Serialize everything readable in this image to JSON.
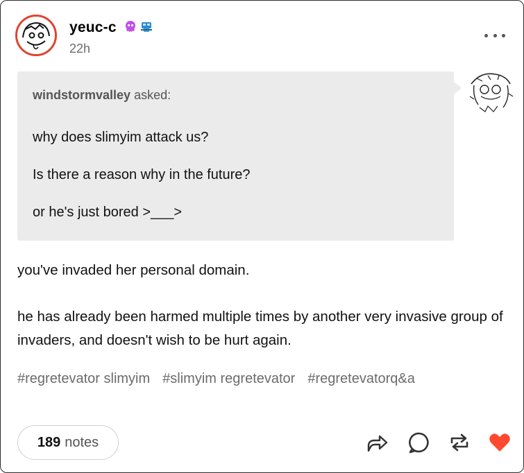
{
  "post": {
    "username": "yeuc-c",
    "timestamp": "22h",
    "badges": [
      "octopus-badge-icon",
      "blue-robot-badge-icon"
    ]
  },
  "ask": {
    "asker": "windstormvalley",
    "asked_suffix": "asked:",
    "lines": [
      "why does slimyim attack us?",
      "Is there a reason why in the future?",
      "or he's just bored >___>"
    ]
  },
  "answer": {
    "paragraphs": [
      "you've invaded her personal domain.",
      "he has already been harmed multiple times by another very invasive group of invaders, and doesn't wish to be hurt again."
    ]
  },
  "tags": [
    "#regretevator slimyim",
    "#slimyim regretevator",
    "#regretevatorq&a"
  ],
  "footer": {
    "notes_count": "189",
    "notes_label": "notes",
    "icons": [
      "share-icon",
      "reply-icon",
      "reblog-icon",
      "like-heart-icon"
    ],
    "like_color": "#ff4930"
  }
}
